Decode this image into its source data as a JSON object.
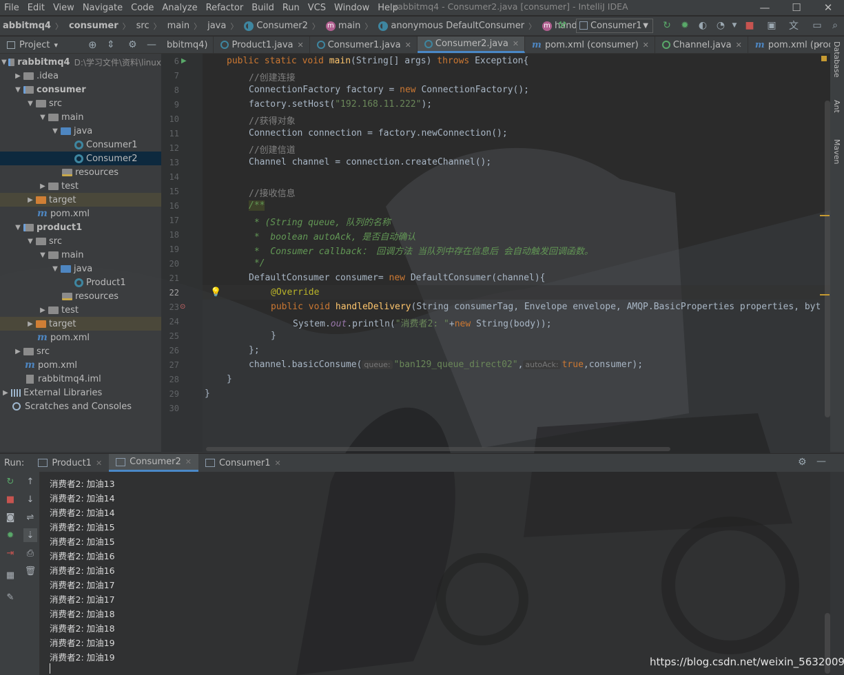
{
  "menu": [
    "File",
    "Edit",
    "View",
    "Navigate",
    "Code",
    "Analyze",
    "Refactor",
    "Build",
    "Run",
    "VCS",
    "Window",
    "Help"
  ],
  "window_title": "rabbitmq4 - Consumer2.java [consumer] - IntelliJ IDEA",
  "breadcrumbs": [
    "abbitmq4",
    "consumer",
    "src",
    "main",
    "java",
    "Consumer2",
    "main",
    "anonymous DefaultConsumer",
    "handleDelivery"
  ],
  "run_config": "Consumer1",
  "project_header": {
    "label": "Project",
    "dropdown": "▾"
  },
  "tabs": [
    {
      "label": "bbitmq4)",
      "active": false
    },
    {
      "label": "Product1.java",
      "active": false
    },
    {
      "label": "Consumer1.java",
      "active": false
    },
    {
      "label": "Consumer2.java",
      "active": true
    },
    {
      "label": "pom.xml (consumer)",
      "active": false
    },
    {
      "label": "Channel.java",
      "active": false
    },
    {
      "label": "pom.xml (product1)",
      "active": false
    }
  ],
  "tree": [
    {
      "label": "rabbitmq4",
      "path": "D:\\学习文件\\资料\\linux"
    },
    {
      "label": ".idea"
    },
    {
      "label": "consumer"
    },
    {
      "label": "src"
    },
    {
      "label": "main"
    },
    {
      "label": "java"
    },
    {
      "label": "Consumer1"
    },
    {
      "label": "Consumer2"
    },
    {
      "label": "resources"
    },
    {
      "label": "test"
    },
    {
      "label": "target"
    },
    {
      "label": "pom.xml"
    },
    {
      "label": "product1"
    },
    {
      "label": "src"
    },
    {
      "label": "main"
    },
    {
      "label": "java"
    },
    {
      "label": "Product1"
    },
    {
      "label": "resources"
    },
    {
      "label": "test"
    },
    {
      "label": "target"
    },
    {
      "label": "pom.xml"
    },
    {
      "label": "src"
    },
    {
      "label": "pom.xml"
    },
    {
      "label": "rabbitmq4.iml"
    },
    {
      "label": "External Libraries"
    },
    {
      "label": "Scratches and Consoles"
    }
  ],
  "line_numbers": [
    "6",
    "7",
    "8",
    "9",
    "10",
    "11",
    "12",
    "13",
    "14",
    "15",
    "16",
    "17",
    "18",
    "19",
    "20",
    "21",
    "22",
    "23",
    "24",
    "25",
    "26",
    "27",
    "28",
    "29",
    "30"
  ],
  "code": {
    "l6a": "public static void ",
    "l6b": "main",
    "l6c": "(String[] args) ",
    "l6d": "throws ",
    "l6e": "Exception{",
    "l7": "//创建连接",
    "l8a": "ConnectionFactory factory = ",
    "l8b": "new ",
    "l8c": "ConnectionFactory();",
    "l9a": "factory.setHost(",
    "l9b": "\"192.168.11.222\"",
    "l9c": ");",
    "l10": "//获得对象",
    "l11": "Connection connection = factory.newConnection();",
    "l12": "//创建信道",
    "l13": "Channel channel = connection.createChannel();",
    "l15": "//接收信息",
    "l16": "/**",
    "l17": " * (String queue, 队列的名称",
    "l18": " *  boolean autoAck, 是否自动确认",
    "l19": " *  Consumer callback： 回调方法 当队列中存在信息后 会自动触发回调函数。",
    "l20": " */",
    "l21a": "DefaultConsumer consumer= ",
    "l21b": "new ",
    "l21c": "DefaultConsumer(channel){",
    "l22": "@Override",
    "l23a": "public void ",
    "l23b": "handleDelivery",
    "l23c": "(String consumerTag, Envelope envelope, AMQP.BasicProperties properties, byt",
    "l24a": "System.",
    "l24b": "out",
    "l24c": ".println(",
    "l24d": "\"消费者2: \"",
    "l24e": "+",
    "l24f": "new ",
    "l24g": "String(body));",
    "l25": "}",
    "l26": "};",
    "l27a": "channel.basicConsume(",
    "l27h1": "queue:",
    "l27b": "\"ban129_queue_direct02\"",
    "l27c": ",",
    "l27h2": "autoAck:",
    "l27d": "true",
    "l27e": ",consumer);",
    "l28": "}",
    "l29": "}"
  },
  "right_tools": [
    "Database",
    "Ant",
    "Maven"
  ],
  "run_panel": {
    "label": "Run:",
    "tabs": [
      {
        "label": "Product1",
        "active": false
      },
      {
        "label": "Consumer2",
        "active": true
      },
      {
        "label": "Consumer1",
        "active": false
      }
    ]
  },
  "console_lines": [
    "消费者2: 加油13",
    "消费者2: 加油14",
    "消费者2: 加油14",
    "消费者2: 加油15",
    "消费者2: 加油15",
    "消费者2: 加油16",
    "消费者2: 加油16",
    "消费者2: 加油17",
    "消费者2: 加油17",
    "消费者2: 加油18",
    "消费者2: 加油18",
    "消费者2: 加油19",
    "消费者2: 加油19"
  ],
  "watermark": "https://blog.csdn.net/weixin_56320090",
  "colors": {
    "accent": "#4a88c7",
    "selection": "#0d293e",
    "keyword": "#cc7832",
    "string": "#6a8759",
    "comment": "#808080"
  }
}
